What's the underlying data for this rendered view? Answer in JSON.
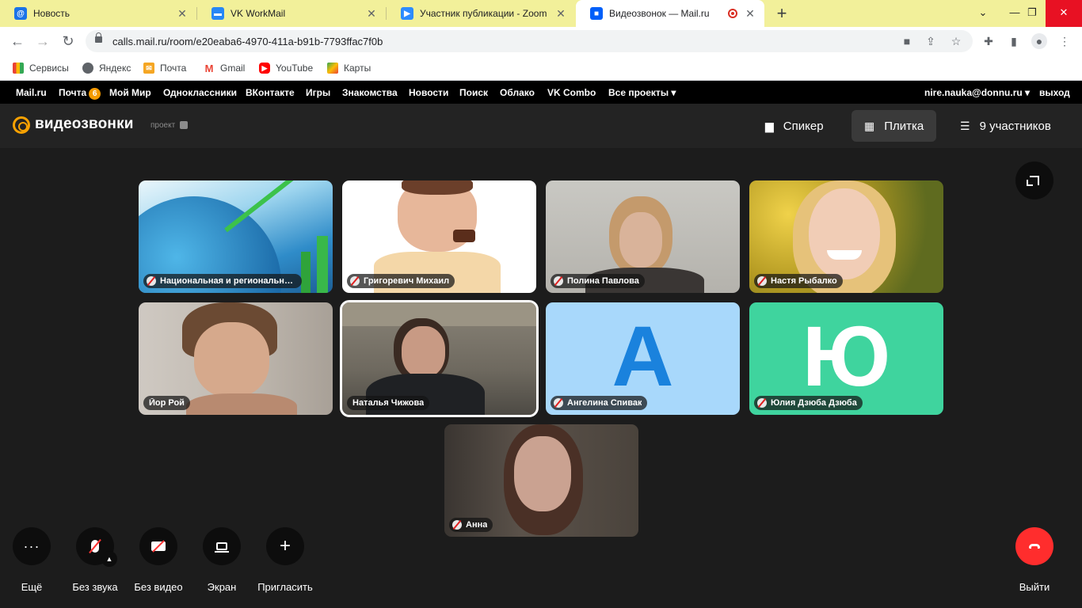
{
  "browser": {
    "tabs": [
      {
        "title": "Новость",
        "icon": "mail-at-icon",
        "color": "#1a73e8"
      },
      {
        "title": "VK WorkMail",
        "icon": "vk-workmail-icon",
        "color": "#2787f5"
      },
      {
        "title": "Участник публикации - Zoom",
        "icon": "zoom-icon",
        "color": "#2d8cff"
      },
      {
        "title": "Видеозвонок — Mail.ru",
        "icon": "video-call-icon",
        "color": "#005ff9",
        "active": true
      }
    ],
    "url": "calls.mail.ru/room/e20eaba6-4970-411a-b91b-7793ffac7f0b",
    "bookmarks": [
      {
        "label": "Сервисы",
        "icon": "apps-grid-icon"
      },
      {
        "label": "Яндекс",
        "icon": "globe-icon"
      },
      {
        "label": "Почта",
        "icon": "mail-envelope-icon"
      },
      {
        "label": "Gmail",
        "icon": "gmail-icon"
      },
      {
        "label": "YouTube",
        "icon": "youtube-icon"
      },
      {
        "label": "Карты",
        "icon": "maps-pin-icon"
      }
    ]
  },
  "portal_nav": {
    "links": [
      "Mail.ru",
      "Почта",
      "Мой Мир",
      "Одноклассники",
      "ВКонтакте",
      "Игры",
      "Знакомства",
      "Новости",
      "Поиск",
      "Облако",
      "VK Combo",
      "Все проекты ▾"
    ],
    "mail_badge": "6",
    "user": "nire.nauka@donnu.ru ▾",
    "logout": "выход"
  },
  "app_header": {
    "logo": "видеозвонки",
    "logo_sub": "проект",
    "speaker_label": "Спикер",
    "tile_label": "Плитка",
    "participants_label": "9 участников"
  },
  "participants": [
    {
      "name": "Национальная и региональная ...",
      "muted": true,
      "kind": "image-globe"
    },
    {
      "name": "Григоревич Михаил",
      "muted": true,
      "kind": "image-cartoon"
    },
    {
      "name": "Полина Павлова",
      "muted": true,
      "kind": "video"
    },
    {
      "name": "Настя Рыбалко",
      "muted": true,
      "kind": "image-photo"
    },
    {
      "name": "Йор Рой",
      "muted": false,
      "kind": "video"
    },
    {
      "name": "Наталья Чижова",
      "muted": false,
      "kind": "video",
      "speaking": true
    },
    {
      "name": "Ангелина Спивак",
      "muted": true,
      "kind": "letter",
      "letter": "А",
      "bg": "#a8d8fb",
      "fg": "#1a82dd"
    },
    {
      "name": "Юлия Дзюба Дзюба",
      "muted": true,
      "kind": "letter",
      "letter": "Ю",
      "bg": "#3fd49e",
      "fg": "#ffffff"
    },
    {
      "name": "Анна",
      "muted": true,
      "kind": "video"
    }
  ],
  "controls": {
    "more": "Ещё",
    "mute": "Без звука",
    "video": "Без видео",
    "screen": "Экран",
    "invite": "Пригласить",
    "leave": "Выйти"
  },
  "colors": {
    "accent": "#f7a102",
    "leave": "#ff2d2d",
    "stage_bg": "#1c1c1c"
  }
}
